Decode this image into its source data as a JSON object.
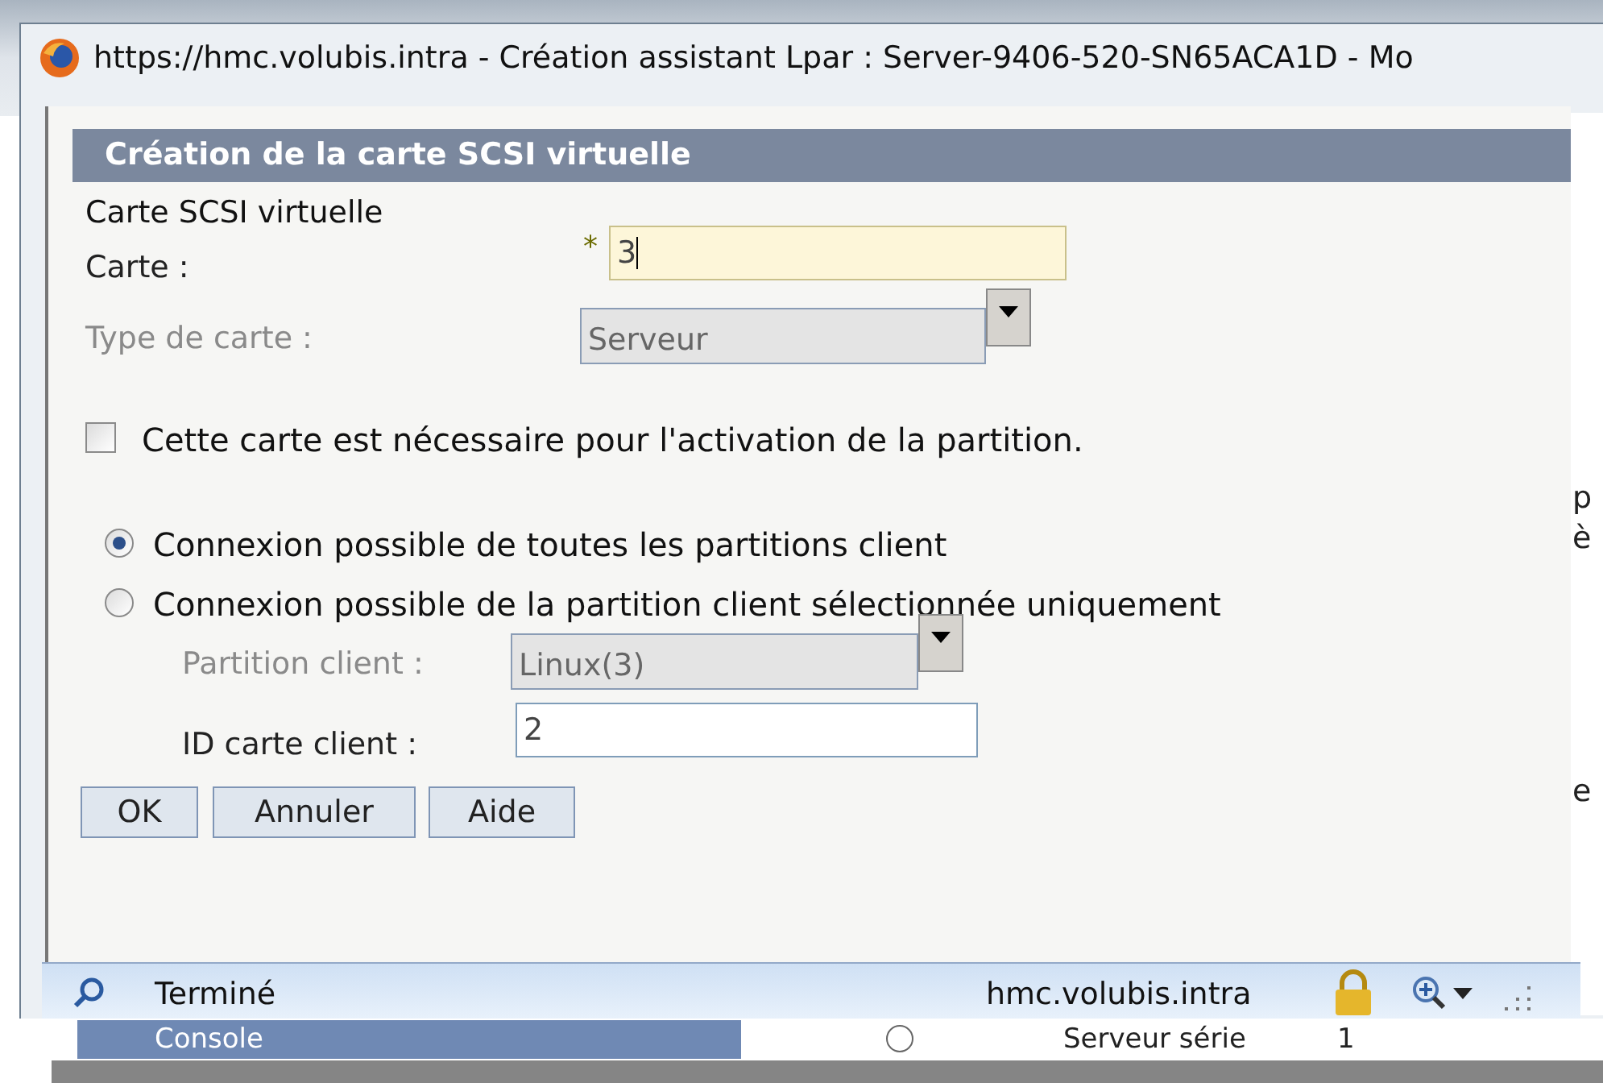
{
  "browser": {
    "title": "https://hmc.volubis.intra - Création assistant Lpar : Server-9406-520-SN65ACA1D - Mo"
  },
  "dialog": {
    "heading": "Création de la carte SCSI virtuelle",
    "section": "Carte SCSI virtuelle",
    "fields": [
      {
        "kind": "text",
        "label": "Carte :",
        "value": "3",
        "required_mark": "*",
        "disabled": false
      },
      {
        "kind": "select",
        "label": "Type de carte :",
        "value": "Serveur",
        "disabled": true
      }
    ],
    "checkbox": {
      "label": "Cette carte est nécessaire pour l'activation de la partition.",
      "checked": false
    },
    "radios": [
      {
        "label": "Connexion possible de toutes les partitions client",
        "selected": true
      },
      {
        "label": "Connexion possible de la partition client sélectionnée uniquement",
        "selected": false
      }
    ],
    "client_fields": [
      {
        "kind": "select",
        "label": "Partition client :",
        "value": "Linux(3)",
        "disabled": true
      },
      {
        "kind": "text",
        "label": "ID carte client :",
        "value": "2",
        "disabled": false
      }
    ],
    "buttons": [
      "OK",
      "Annuler",
      "Aide"
    ]
  },
  "status_bar": {
    "text": "Terminé",
    "host": "hmc.volubis.intra"
  },
  "background": {
    "side_letters": [
      "p",
      "è",
      "e"
    ],
    "row": {
      "cells": [
        "Console",
        "Serveur série",
        "1"
      ],
      "radio_selected": false
    }
  }
}
